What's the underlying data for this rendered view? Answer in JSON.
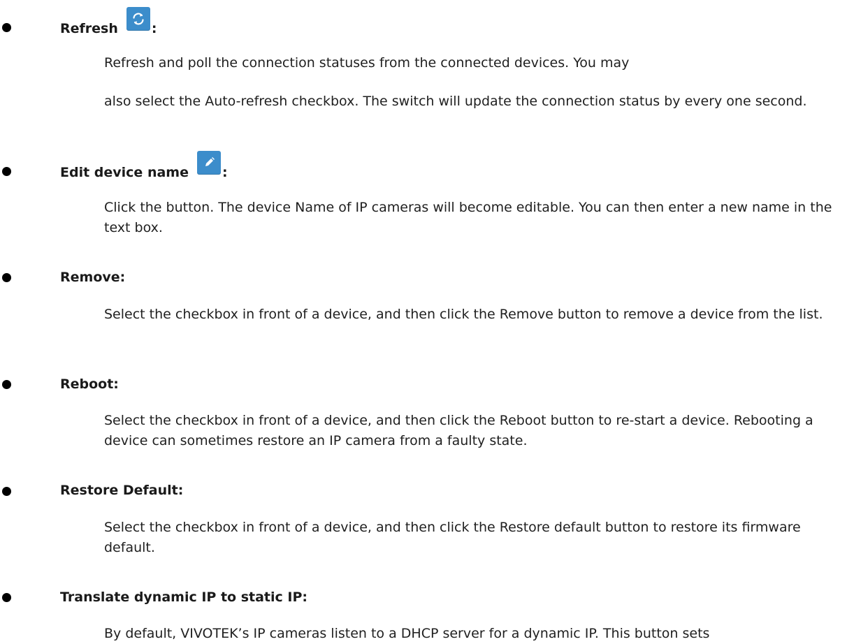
{
  "items": [
    {
      "heading": "Refresh",
      "colon": ":",
      "icon": "refresh-icon",
      "paragraphs": [
        "Refresh and poll the connection statuses from the connected devices. You may",
        "also select the Auto-refresh checkbox. The switch will update the connection status by every one second."
      ]
    },
    {
      "heading": "Edit device name",
      "colon": ":",
      "icon": "pencil-icon",
      "paragraphs": [
        "Click the button. The device Name of IP cameras will become editable. You can then enter a new name in the text box."
      ]
    },
    {
      "heading": "Remove:",
      "paragraphs": [
        "Select the checkbox in front of a device, and then click the Remove button to remove a device from the list."
      ]
    },
    {
      "heading": "Reboot:",
      "paragraphs": [
        "Select the checkbox in front of a device, and then click the Reboot button to re-start a device. Rebooting a device can sometimes restore an IP camera from a faulty state."
      ]
    },
    {
      "heading": "Restore Default:",
      "paragraphs": [
        "Select the checkbox in front of a device, and then click the Restore default button to restore its firmware default."
      ]
    },
    {
      "heading": "Translate dynamic IP to static IP:",
      "paragraphs": [
        "By default, VIVOTEK’s IP cameras listen to a DHCP server for a dynamic IP. This button sets"
      ]
    }
  ],
  "colors": {
    "icon_button": "#3c8dcb",
    "text": "#1f1f1f"
  }
}
